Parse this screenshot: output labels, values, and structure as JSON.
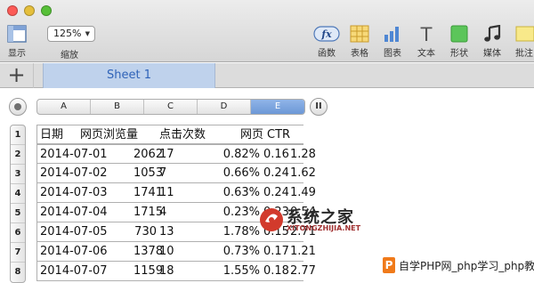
{
  "toolbar": {
    "display_label": "显示",
    "zoom_value": "125%",
    "zoom_label": "缩放",
    "function_label": "函数",
    "function_badge": "fx",
    "table_label": "表格",
    "chart_label": "图表",
    "text_label": "文本",
    "text_glyph": "T",
    "shape_label": "形状",
    "media_label": "媒体",
    "comment_label": "批注"
  },
  "tabs": {
    "add_glyph": "+",
    "sheet_name": "Sheet 1"
  },
  "sheet": {
    "columns": [
      "A",
      "B",
      "C",
      "D",
      "E"
    ],
    "selected_column": "E",
    "pause_glyph": "II",
    "row_numbers": [
      "1",
      "2",
      "3",
      "4",
      "5",
      "6",
      "7",
      "8"
    ],
    "header": {
      "date": "日期",
      "pageviews": "网页浏览量",
      "clicks": "点击次数",
      "page": "网页",
      "ctr": "CTR"
    },
    "rows": [
      {
        "date": "2014-07-01",
        "pageviews": "2062",
        "clicks": "17",
        "ctr": "0.82%",
        "v1": "0.16",
        "v2": "1.28"
      },
      {
        "date": "2014-07-02",
        "pageviews": "1053",
        "clicks": "7",
        "ctr": "0.66%",
        "v1": "0.24",
        "v2": "1.62"
      },
      {
        "date": "2014-07-03",
        "pageviews": "1741",
        "clicks": "11",
        "ctr": "0.63%",
        "v1": "0.24",
        "v2": "1.49"
      },
      {
        "date": "2014-07-04",
        "pageviews": "1715",
        "clicks": "4",
        "ctr": "0.23%",
        "v1": "0.23",
        "v2": "0.54"
      },
      {
        "date": "2014-07-05",
        "pageviews": "730",
        "clicks": "13",
        "ctr": "1.78%",
        "v1": "0.15",
        "v2": "2.71"
      },
      {
        "date": "2014-07-06",
        "pageviews": "1378",
        "clicks": "10",
        "ctr": "0.73%",
        "v1": "0.17",
        "v2": "1.21"
      },
      {
        "date": "2014-07-07",
        "pageviews": "1159",
        "clicks": "18",
        "ctr": "1.55%",
        "v1": "0.18",
        "v2": "2.77"
      }
    ]
  },
  "watermarks": {
    "site_title": "系统之家",
    "site_url": "XITONGZHIJIA.NET",
    "bottom_badge": "P",
    "bottom_text": "自学PHP网_php学习_php教"
  },
  "colors": {
    "sheet_tab_bg": "#bfd2ec",
    "sheet_tab_text": "#2f63b8",
    "selected_column": "#7aa3dd",
    "close": "#fc5b57",
    "minimize": "#e5bf3c",
    "maximize": "#57c038"
  }
}
